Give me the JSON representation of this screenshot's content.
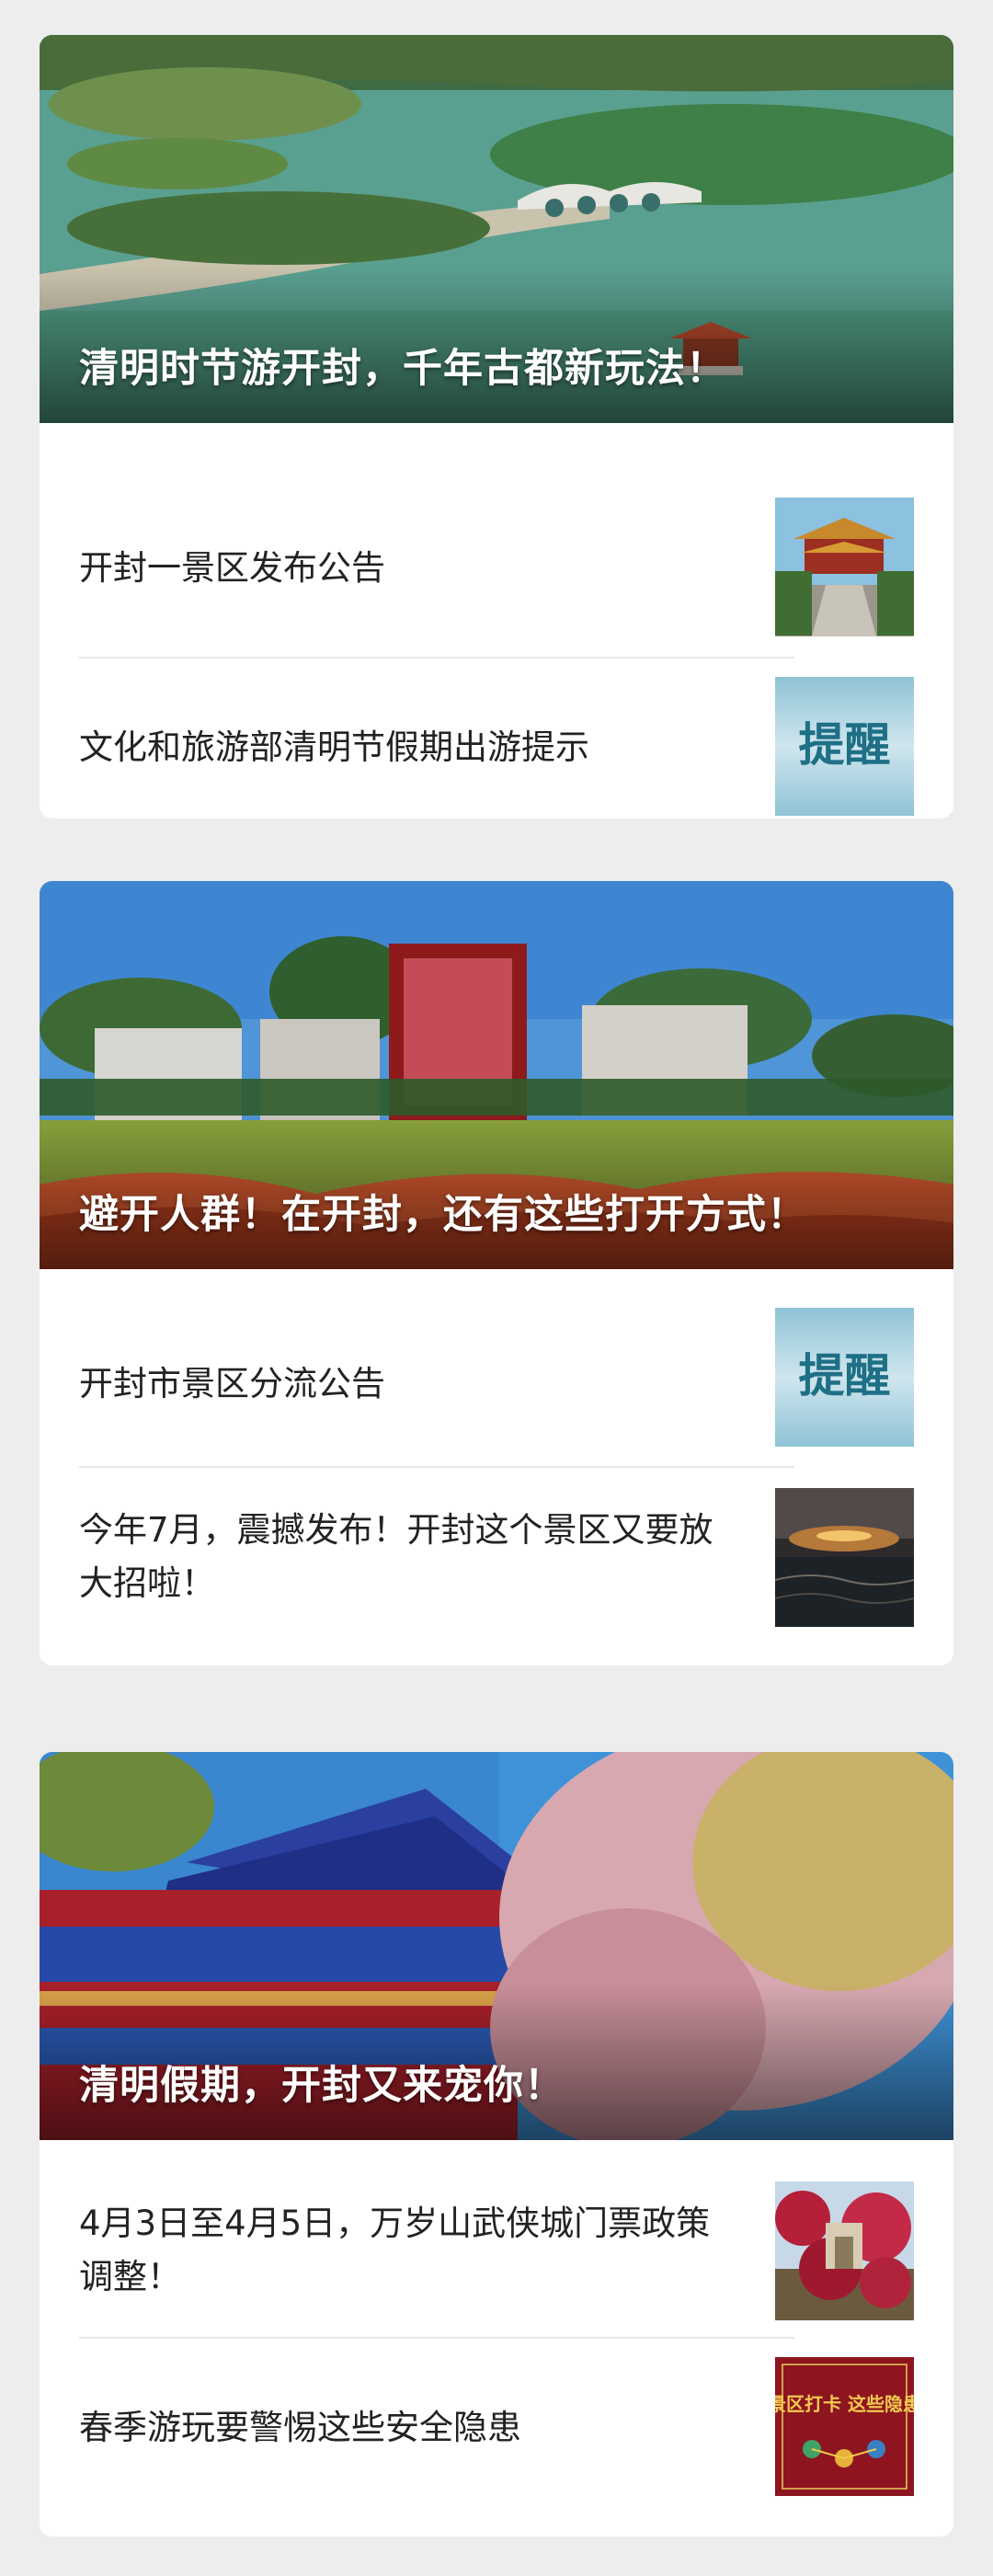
{
  "cards": [
    {
      "hero_title": "清明时节游开封，千年古都新玩法！",
      "items": [
        {
          "title": "开封一景区发布公告",
          "thumb_icon": "pavilion-photo"
        },
        {
          "title": "文化和旅游部清明节假期出游提示",
          "thumb_icon": "reminder-badge",
          "thumb_text": "提醒"
        }
      ]
    },
    {
      "hero_title": "避开人群！在开封，还有这些打开方式！",
      "items": [
        {
          "title": "开封市景区分流公告",
          "thumb_icon": "reminder-badge",
          "thumb_text": "提醒"
        },
        {
          "title": "今年7月，震撼发布！开封这个景区又要放大招啦！",
          "thumb_icon": "night-lake-photo"
        }
      ]
    },
    {
      "hero_title": "清明假期，开封又来宠你！",
      "items": [
        {
          "title": "4月3日至4月5日，万岁山武侠城门票政策调整！",
          "thumb_icon": "blossom-photo"
        },
        {
          "title": "春季游玩要警惕这些安全隐患",
          "thumb_icon": "safety-poster",
          "thumb_text": "景区打卡 这些隐患"
        }
      ]
    }
  ],
  "colors": {
    "page_bg": "#ededed",
    "card_bg": "#ffffff",
    "title_text": "#222222",
    "hero_text": "#ffffff",
    "reminder_bg": "#a9d2e0",
    "reminder_text": "#1f6f86"
  }
}
